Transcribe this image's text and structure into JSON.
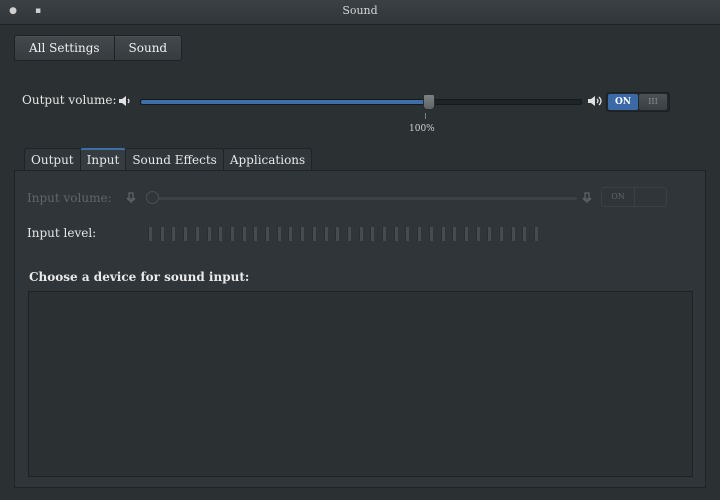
{
  "window": {
    "title": "Sound"
  },
  "breadcrumb": {
    "all_settings": "All Settings",
    "sound": "Sound"
  },
  "output_volume": {
    "label": "Output volume:",
    "percent_label": "100%",
    "level": 0.655,
    "switch_on": "ON",
    "switch_knob": "III"
  },
  "tabs": [
    {
      "label": "Output"
    },
    {
      "label": "Input"
    },
    {
      "label": "Sound Effects"
    },
    {
      "label": "Applications"
    }
  ],
  "input": {
    "volume_label": "Input volume:",
    "switch_on": "ON",
    "level_label": "Input level:",
    "choose_label": "Choose a device for sound input:"
  },
  "colors": {
    "accent": "#3f6fa8",
    "background": "#2b3032"
  },
  "icons": {
    "low_volume": "speaker-low-icon",
    "high_volume": "speaker-high-icon",
    "mic": "microphone-icon"
  }
}
